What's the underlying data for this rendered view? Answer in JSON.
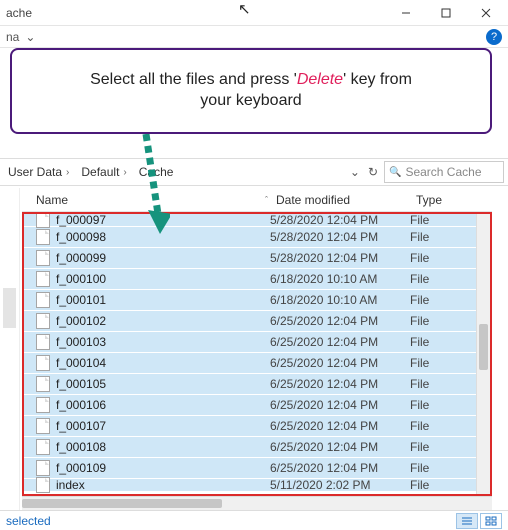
{
  "window": {
    "title": "ache"
  },
  "ribbon": {
    "partial_tab": "na"
  },
  "callout": {
    "line1_before": "Select all the files and press '",
    "line1_em": "Delete",
    "line1_after": "' key from",
    "line2": "your keyboard"
  },
  "breadcrumb": {
    "items": [
      "User Data",
      "Default",
      "Cache"
    ],
    "dropdown_glyph": "⌄",
    "refresh_glyph": "↻"
  },
  "search": {
    "placeholder": "Search Cache",
    "icon_glyph": "🔍"
  },
  "columns": {
    "name": "Name",
    "date": "Date modified",
    "type": "Type",
    "sort_glyph": "ˆ"
  },
  "files": [
    {
      "name": "f_000097",
      "date": "5/28/2020 12:04 PM",
      "type": "File",
      "partial": "top"
    },
    {
      "name": "f_000098",
      "date": "5/28/2020 12:04 PM",
      "type": "File"
    },
    {
      "name": "f_000099",
      "date": "5/28/2020 12:04 PM",
      "type": "File"
    },
    {
      "name": "f_000100",
      "date": "6/18/2020 10:10 AM",
      "type": "File"
    },
    {
      "name": "f_000101",
      "date": "6/18/2020 10:10 AM",
      "type": "File"
    },
    {
      "name": "f_000102",
      "date": "6/25/2020 12:04 PM",
      "type": "File"
    },
    {
      "name": "f_000103",
      "date": "6/25/2020 12:04 PM",
      "type": "File"
    },
    {
      "name": "f_000104",
      "date": "6/25/2020 12:04 PM",
      "type": "File"
    },
    {
      "name": "f_000105",
      "date": "6/25/2020 12:04 PM",
      "type": "File"
    },
    {
      "name": "f_000106",
      "date": "6/25/2020 12:04 PM",
      "type": "File"
    },
    {
      "name": "f_000107",
      "date": "6/25/2020 12:04 PM",
      "type": "File"
    },
    {
      "name": "f_000108",
      "date": "6/25/2020 12:04 PM",
      "type": "File"
    },
    {
      "name": "f_000109",
      "date": "6/25/2020 12:04 PM",
      "type": "File"
    },
    {
      "name": "index",
      "date": "5/11/2020 2:02 PM",
      "type": "File",
      "partial": "bottom"
    }
  ],
  "status": {
    "text": "selected"
  },
  "colors": {
    "callout_border": "#4b1a7a",
    "highlight": "#cfe7f7",
    "red_frame": "#db2a2a",
    "arrow": "#16937d"
  }
}
